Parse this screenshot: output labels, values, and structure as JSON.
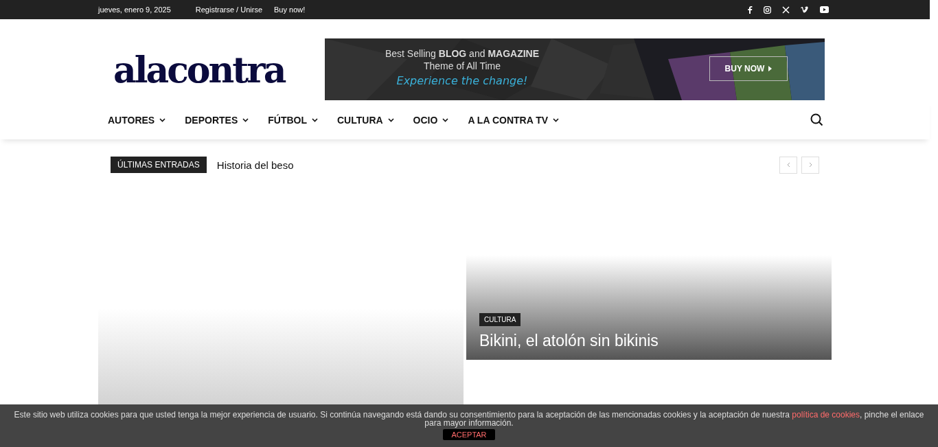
{
  "top_bar": {
    "date": "jueves, enero 9, 2025",
    "links": [
      "Registrarse / Unirse",
      "Buy now!"
    ],
    "social": [
      {
        "kind": "facebook"
      },
      {
        "kind": "instagram"
      },
      {
        "kind": "x"
      },
      {
        "kind": "vimeo"
      },
      {
        "kind": "youtube"
      }
    ]
  },
  "header": {
    "logo": "alacontra",
    "banner": {
      "headline": "Best Selling **BLOG** and **MAGAZINE**",
      "subline": "Theme of All Time",
      "tagline": "Experience the change!",
      "button": "BUY NOW"
    }
  },
  "nav": {
    "items": [
      {
        "label": "AUTORES"
      },
      {
        "label": "DEPORTES"
      },
      {
        "label": "FÚTBOL"
      },
      {
        "label": "CULTURA"
      },
      {
        "label": "OCIO"
      },
      {
        "label": "A LA CONTRA TV"
      }
    ]
  },
  "ticker": {
    "label": "ÚLTIMAS ENTRADAS",
    "headline": "Historia del beso"
  },
  "featured": [
    {
      "kind": "blank"
    },
    {
      "kind": "post",
      "category": "CULTURA",
      "title": "Bikini, el atolón sin bikinis"
    }
  ],
  "cookie_bar": {
    "text_before": "Este sitio web utiliza cookies para que usted tenga la mejor experiencia de usuario. Si continúa navegando está dando su consentimiento para la aceptación de las mencionadas cookies y la aceptación de nuestra",
    "link": "política de cookies",
    "text_after": ", pinche el enlace para mayor información.",
    "button": "ACEPTAR"
  }
}
